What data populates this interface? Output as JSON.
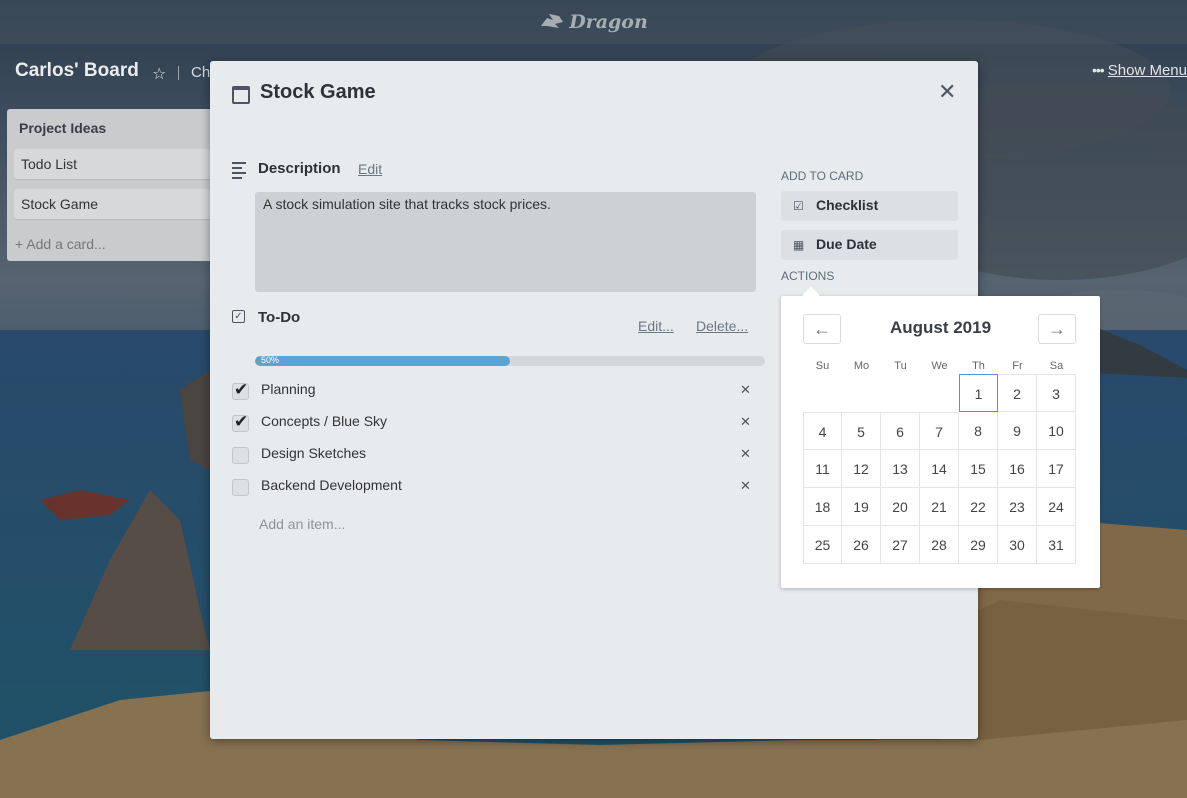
{
  "app": {
    "logo_text": "Dragon"
  },
  "board": {
    "title": "Carlos' Board",
    "chip": "Ch",
    "show_menu": "Show Menu"
  },
  "list": {
    "title": "Project Ideas",
    "cards": [
      "Todo List",
      "Stock Game"
    ],
    "add_card": "+ Add a card..."
  },
  "card": {
    "title": "Stock Game",
    "description": {
      "heading": "Description",
      "edit": "Edit",
      "text": "A stock simulation site that tracks stock prices."
    },
    "checklist": {
      "heading": "To-Do",
      "edit": "Edit...",
      "delete": "Delete...",
      "progress": 0.5,
      "progress_label": "50%",
      "items": [
        {
          "label": "Planning",
          "checked": true
        },
        {
          "label": "Concepts / Blue Sky",
          "checked": true
        },
        {
          "label": "Design Sketches",
          "checked": false
        },
        {
          "label": "Backend Development",
          "checked": false
        }
      ],
      "add_item": "Add an item..."
    },
    "sidebar": {
      "add_heading": "ADD TO CARD",
      "checklist_btn": "Checklist",
      "due_date_btn": "Due Date",
      "actions_heading": "ACTIONS"
    }
  },
  "calendar": {
    "month_label": "August 2019",
    "weekdays": [
      "Su",
      "Mo",
      "Tu",
      "We",
      "Th",
      "Fr",
      "Sa"
    ],
    "first_weekday": 4,
    "days_in_month": 31,
    "selected_day": 1
  },
  "colors": {
    "progress": "#5ba4cf",
    "modal_bg": "#e8ebee",
    "today_border": "#5b8fd9"
  }
}
